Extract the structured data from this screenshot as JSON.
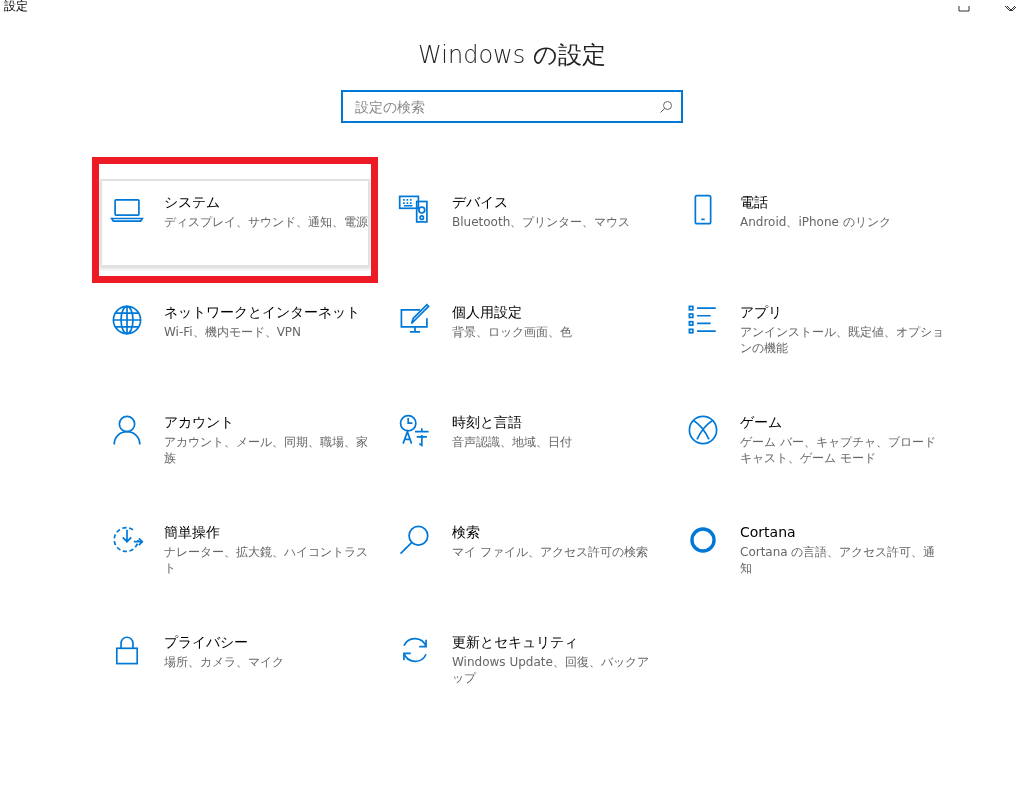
{
  "window": {
    "title": "設定"
  },
  "heading": "Windows の設定",
  "search": {
    "placeholder": "設定の検索"
  },
  "categories": [
    {
      "title": "システム",
      "description": "ディスプレイ、サウンド、通知、電源",
      "selected": true,
      "marked": true
    },
    {
      "title": "デバイス",
      "description": "Bluetooth、プリンター、マウス",
      "selected": false,
      "marked": false
    },
    {
      "title": "電話",
      "description": "Android、iPhone のリンク",
      "selected": false,
      "marked": false
    },
    {
      "title": "ネットワークとインターネット",
      "description": "Wi-Fi、機内モード、VPN",
      "selected": false,
      "marked": false
    },
    {
      "title": "個人用設定",
      "description": "背景、ロック画面、色",
      "selected": false,
      "marked": false
    },
    {
      "title": "アプリ",
      "description": "アンインストール、既定値、オプションの機能",
      "selected": false,
      "marked": false
    },
    {
      "title": "アカウント",
      "description": "アカウント、メール、同期、職場、家族",
      "selected": false,
      "marked": false
    },
    {
      "title": "時刻と言語",
      "description": "音声認識、地域、日付",
      "selected": false,
      "marked": false
    },
    {
      "title": "ゲーム",
      "description": "ゲーム バー、キャプチャ、ブロードキャスト、ゲーム モード",
      "selected": false,
      "marked": false
    },
    {
      "title": "簡単操作",
      "description": "ナレーター、拡大鏡、ハイコントラスト",
      "selected": false,
      "marked": false
    },
    {
      "title": "検索",
      "description": "マイ ファイル、アクセス許可の検索",
      "selected": false,
      "marked": false
    },
    {
      "title": "Cortana",
      "description": "Cortana の言語、アクセス許可、通知",
      "selected": false,
      "marked": false
    },
    {
      "title": "プライバシー",
      "description": "場所、カメラ、マイク",
      "selected": false,
      "marked": false
    },
    {
      "title": "更新とセキュリティ",
      "description": "Windows Update、回復、バックアップ",
      "selected": false,
      "marked": false
    }
  ]
}
